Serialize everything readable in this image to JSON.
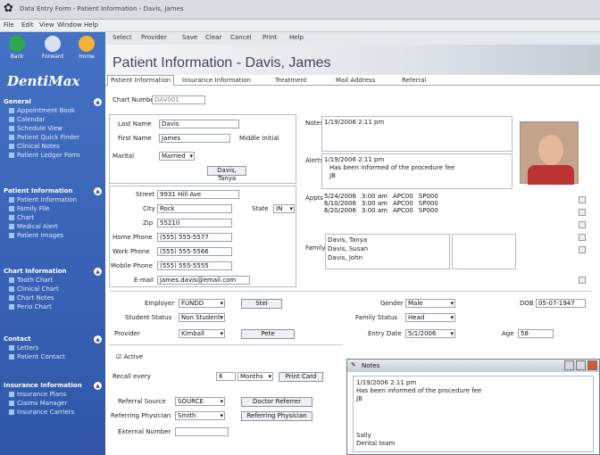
{
  "window": {
    "title": "Data Entry Form - Patient Information - Davis, James"
  },
  "menu": [
    "File",
    "Edit",
    "View",
    "Window",
    "Help"
  ],
  "sidebar": {
    "buttons": [
      "Back",
      "Forward",
      "Home"
    ],
    "brand": "DentiMax",
    "sections": [
      {
        "title": "General",
        "items": [
          "Appointment Book",
          "Calendar",
          "Schedule View",
          "Patient Quick Finder",
          "Clinical Notes",
          "Patient Ledger Form"
        ]
      },
      {
        "title": "Patient Information",
        "items": [
          "Patient Information",
          "Family File",
          "Chart",
          "Medical Alert",
          "Patient Images"
        ]
      },
      {
        "title": "Chart Information",
        "items": [
          "Tooth Chart",
          "Clinical Chart",
          "Chart Notes",
          "Perio Chart"
        ]
      },
      {
        "title": "Contact",
        "items": [
          "Letters",
          "Patient Contact"
        ]
      },
      {
        "title": "Insurance Information",
        "items": [
          "Insurance Plans",
          "Claims Manager",
          "Insurance Carriers"
        ]
      }
    ]
  },
  "toolbar": [
    "Select",
    "Provider",
    "Save",
    "Clear",
    "Cancel",
    "Print",
    "Help"
  ],
  "header": {
    "title": "Patient Information - Davis, James"
  },
  "tabs": [
    "Patient Information",
    "Insurance Information",
    "Treatment",
    "Mail Address",
    "Referral"
  ],
  "patient": {
    "id_label": "Chart Number",
    "id_value": "DAV001",
    "last_label": "Last Name",
    "last": "Davis",
    "first_label": "First Name",
    "first": "James",
    "mi_label": "Middle Initial",
    "marital_label": "Marital",
    "marital": "Married",
    "spouse_btn": "Davis, Tanya",
    "street_label": "Street",
    "street": "9931 Hill Ave",
    "city_label": "City",
    "city": "Rock",
    "state_label": "State",
    "state": "IN",
    "zip_label": "Zip",
    "zip": "55210",
    "home_label": "Home Phone",
    "home": "(555) 555-5577",
    "work_label": "Work Phone",
    "work": "(555) 555-5566",
    "mobile_label": "Mobile Phone",
    "mobile": "(555) 555-5555",
    "email_label": "E-mail",
    "email": "james.davis@email.com"
  },
  "notes": {
    "label": "Notes",
    "entry": "1/19/2006 2:11 pm"
  },
  "alerts": {
    "label": "Alerts",
    "entry": "1/19/2006 2:11 pm",
    "text": "Has been informed of the procedure fee",
    "initials": "JB"
  },
  "appointments": {
    "label": "Appts",
    "rows": [
      [
        "5/24/2006",
        "3:00 am",
        "APC00",
        "SP000"
      ],
      [
        "6/10/2006",
        "3:00 am",
        "APC00",
        "SP000"
      ],
      [
        "6/20/2006",
        "3:00 am",
        "APC00",
        "SP000"
      ]
    ]
  },
  "family": {
    "label": "Family",
    "members": [
      "Davis, Tanya",
      "Davis, Susan",
      "Davis, John"
    ]
  },
  "employer": {
    "label": "Employer",
    "value": "FUNDD",
    "btn": "Stel"
  },
  "student": {
    "label": "Student Status",
    "value": "Non Student"
  },
  "provider": {
    "label": "Provider",
    "value": "Kimball",
    "btn": "Pete"
  },
  "gender": {
    "label": "Gender",
    "value": "Male"
  },
  "dob": {
    "label": "DOB",
    "value": "05-07-1947"
  },
  "status": {
    "label": "Family Status",
    "value": "Head"
  },
  "entry": {
    "label": "Entry Date",
    "value": "5/1/2006",
    "age_label": "Age",
    "age": "58"
  },
  "active": {
    "label": "Active",
    "recall_label": "Recall every",
    "months": "6",
    "unit": "Months",
    "btn": "Print Card"
  },
  "referral": {
    "label": "Referral Source",
    "value": "SOURCE",
    "btn": "Doctor Referrer",
    "rp_label": "Referring Physician",
    "rp": "Smith",
    "rp_btn": "Referring Physician"
  },
  "external": {
    "label": "External Number"
  },
  "popup": {
    "title": "Notes",
    "entry": "1/19/2006 2:11 pm",
    "line": "Has been informed of the procedure fee",
    "initials": "JB",
    "sig": "Sally",
    "sig2": "Dental team"
  },
  "colors": {
    "sidebar": "#2f56a9",
    "accent": "#4472c4"
  }
}
